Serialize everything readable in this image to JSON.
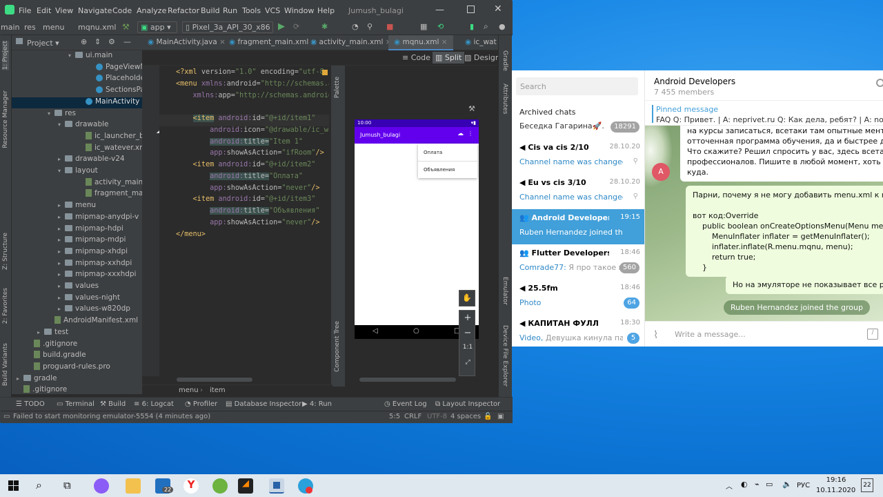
{
  "studio": {
    "menu": [
      "File",
      "Edit",
      "View",
      "Navigate",
      "Code",
      "Analyze",
      "Refactor",
      "Build",
      "Run",
      "Tools",
      "VCS",
      "Window",
      "Help"
    ],
    "project_name": "Jumush_bulagi",
    "toolbar": {
      "crumb_main": "main",
      "crumb_res": "res",
      "crumb_menu": "menu",
      "crumb_file": "mqnu.xml",
      "run_config": "app",
      "device": "Pixel_3a_API_30_x86"
    },
    "project_panel_label": "Project",
    "side_tabs_left": [
      "1: Project",
      "Resource Manager",
      "Z: Structure",
      "2: Favorites",
      "Build Variants"
    ],
    "side_tabs_right": [
      "Gradle",
      "Attributes",
      "Emulator",
      "Device File Explorer"
    ],
    "design_side_tabs": [
      "Palette",
      "Component Tree"
    ],
    "tree": [
      {
        "label": "ui.main",
        "indent": 110,
        "type": "folder",
        "arrow": "▾"
      },
      {
        "label": "PageViewM",
        "indent": 140,
        "type": "class",
        "arrow": ""
      },
      {
        "label": "Placeholder",
        "indent": 140,
        "type": "class",
        "arrow": ""
      },
      {
        "label": "SectionsPag",
        "indent": 140,
        "type": "class",
        "arrow": ""
      },
      {
        "label": "MainActivity",
        "indent": 125,
        "type": "class",
        "arrow": "",
        "selected": true
      },
      {
        "label": "res",
        "indent": 80,
        "type": "folder",
        "arrow": "▾"
      },
      {
        "label": "drawable",
        "indent": 95,
        "type": "folder",
        "arrow": "▾"
      },
      {
        "label": "ic_launcher_bac",
        "indent": 125,
        "type": "file",
        "arrow": ""
      },
      {
        "label": "ic_watever.xml",
        "indent": 125,
        "type": "file",
        "arrow": ""
      },
      {
        "label": "drawable-v24",
        "indent": 95,
        "type": "folder",
        "arrow": "▸"
      },
      {
        "label": "layout",
        "indent": 95,
        "type": "folder",
        "arrow": "▾"
      },
      {
        "label": "activity_main.x",
        "indent": 125,
        "type": "file",
        "arrow": ""
      },
      {
        "label": "fragment_main",
        "indent": 125,
        "type": "file",
        "arrow": ""
      },
      {
        "label": "menu",
        "indent": 95,
        "type": "folder",
        "arrow": "▸"
      },
      {
        "label": "mipmap-anydpi-v",
        "indent": 95,
        "type": "folder",
        "arrow": "▸"
      },
      {
        "label": "mipmap-hdpi",
        "indent": 95,
        "type": "folder",
        "arrow": "▸"
      },
      {
        "label": "mipmap-mdpi",
        "indent": 95,
        "type": "folder",
        "arrow": "▸"
      },
      {
        "label": "mipmap-xhdpi",
        "indent": 95,
        "type": "folder",
        "arrow": "▸"
      },
      {
        "label": "mipmap-xxhdpi",
        "indent": 95,
        "type": "folder",
        "arrow": "▸"
      },
      {
        "label": "mipmap-xxxhdpi",
        "indent": 95,
        "type": "folder",
        "arrow": "▸"
      },
      {
        "label": "values",
        "indent": 95,
        "type": "folder",
        "arrow": "▸"
      },
      {
        "label": "values-night",
        "indent": 95,
        "type": "folder",
        "arrow": "▸"
      },
      {
        "label": "values-w820dp",
        "indent": 95,
        "type": "folder",
        "arrow": "▸"
      },
      {
        "label": "AndroidManifest.xml",
        "indent": 80,
        "type": "file",
        "arrow": ""
      },
      {
        "label": "test",
        "indent": 65,
        "type": "folder",
        "arrow": "▸"
      },
      {
        "label": ".gitignore",
        "indent": 50,
        "type": "file",
        "arrow": ""
      },
      {
        "label": "build.gradle",
        "indent": 50,
        "type": "file",
        "arrow": ""
      },
      {
        "label": "proguard-rules.pro",
        "indent": 50,
        "type": "file",
        "arrow": ""
      },
      {
        "label": "gradle",
        "indent": 35,
        "type": "folder",
        "arrow": "▸"
      },
      {
        "label": ".gitignore",
        "indent": 35,
        "type": "file",
        "arrow": ""
      }
    ],
    "tabs": [
      "MainActivity.java",
      "fragment_main.xml",
      "activity_main.xml",
      "mqnu.xml",
      "ic_wat"
    ],
    "active_tab": 3,
    "view_modes": [
      "Code",
      "Split",
      "Design"
    ],
    "code": [
      {
        "n": "1",
        "html": "<span class='tag'>&lt;?xml</span> <span class='attr'>version=</span><span class='val'>\"1.0\"</span> <span class='attr'>encoding=</span><span class='val'>\"utf-8</span>"
      },
      {
        "n": "2",
        "html": "<span class='tag'>&lt;menu</span> <span class='ns'>xmlns:</span><span class='attr'>android=</span><span class='val'>\"http://schemas.a</span>"
      },
      {
        "n": "3",
        "html": "    <span class='ns'>xmlns:</span><span class='attr'>app=</span><span class='val'>\"http://schemas.android</span>"
      },
      {
        "n": "4",
        "html": ""
      },
      {
        "n": "5",
        "html": "    <span class='tag hlt'>&lt;item</span> <span class='ns'>android:</span><span class='attr'>id=</span><span class='val'>\"@+id/item1\"</span>"
      },
      {
        "n": "6",
        "html": "        <span class='ns'>android:</span><span class='attr'>icon=</span><span class='val'>\"@drawable/ic_wa</span>"
      },
      {
        "n": "7",
        "html": "        <span class='hlt'><span class='ns'>android:</span><span class='attr'>title=</span></span><span class='val'>\"Item 1\"</span>"
      },
      {
        "n": "8",
        "html": "        <span class='ns'>app:</span><span class='attr'>showAsAction=</span><span class='val'>\"ifRoom\"</span><span class='tag'>/&gt;</span>"
      },
      {
        "n": "9",
        "html": "    <span class='tag'>&lt;item</span> <span class='ns'>android:</span><span class='attr'>id=</span><span class='val'>\"@+id/item2\"</span>"
      },
      {
        "n": "10",
        "html": "        <span class='hlt'><span class='ns'>android:</span><span class='attr'>title=</span></span><span class='val'>\"Оплата\"</span>"
      },
      {
        "n": "11",
        "html": "        <span class='ns'>app:</span><span class='attr'>showAsAction=</span><span class='val'>\"never\"</span><span class='tag'>/&gt;</span>"
      },
      {
        "n": "12",
        "html": "    <span class='tag'>&lt;item</span> <span class='ns'>android:</span><span class='attr'>id=</span><span class='val'>\"@+id/item3\"</span>"
      },
      {
        "n": "13",
        "html": "        <span class='hlt'><span class='ns'>android:</span><span class='attr'>title=</span></span><span class='val'>\"Объявления\"</span>"
      },
      {
        "n": "14",
        "html": "        <span class='ns'>app:</span><span class='attr'>showAsAction=</span><span class='val'>\"never\"</span><span class='tag'>/&gt;</span>"
      },
      {
        "n": "15",
        "html": "<span class='tag'>&lt;/menu&gt;</span>"
      }
    ],
    "breadcrumb": [
      "menu",
      "item"
    ],
    "preview": {
      "time": "10:00",
      "app_title": "Jumush_bulagi",
      "menu_items": [
        "Оплата",
        "Объявления"
      ],
      "zoom_ratio": "1:1"
    },
    "bottom_tools": [
      "TODO",
      "Terminal",
      "Build",
      "6: Logcat",
      "Profiler",
      "Database Inspector",
      "4: Run",
      "Event Log",
      "Layout Inspector"
    ],
    "status": {
      "message": "Failed to start monitoring emulator-5554 (4 minutes ago)",
      "position": "5:5",
      "line_sep": "CRLF",
      "encoding": "UTF-8",
      "indent": "4 spaces"
    }
  },
  "telegram": {
    "search_placeholder": "Search",
    "archived": {
      "title": "Archived chats",
      "preview": "Беседка Гагарина🚀. F...",
      "badge": "18291"
    },
    "chats": [
      {
        "title": "Cis va cis 2/10",
        "date": "28.10.20",
        "preview_hl": "Channel name was changed ...",
        "preview": "",
        "badge": "",
        "pin": true
      },
      {
        "title": "Eu vs cis 3/10",
        "date": "28.10.20",
        "preview_hl": "Channel name was changed ...",
        "preview": "",
        "badge": "",
        "pin": true
      },
      {
        "title": "Android Developers",
        "date": "19:15",
        "preview_hl": "Ruben Hernandez joined the gro...",
        "preview": "",
        "badge": "",
        "selected": true
      },
      {
        "title": "Flutter Developers — p...",
        "date": "18:46",
        "preview_hl": "Comrade77:",
        "preview": " Я про такое н...",
        "badge": "560"
      },
      {
        "title": "25.5fm",
        "date": "18:46",
        "preview_hl": "Photo",
        "preview": "",
        "badge": "64",
        "blue": true
      },
      {
        "title": "КАПИТАН ФУЛЛ",
        "date": "18:30",
        "preview_hl": "Video,",
        "preview": " Девушка кинула паца...",
        "badge": "5",
        "blue": true
      }
    ],
    "header": {
      "title": "Android Developers",
      "members": "7 455 members"
    },
    "pinned": {
      "label": "Pinned message",
      "text": "FAQ Q: Привет. | A: neprivet.ru Q: Как дела, ребят? | A: nometa.xyz"
    },
    "messages": {
      "first": [
        "на курсы записаться, всетаки там опытные менторы,",
        "отточенная программа обучения, да и быстрее дело пойдет",
        "Что скажите? Решил спросить у вас, здесь всетаки много",
        "профессионалов. Пишите в любой момент, хоть в личку",
        "куда."
      ],
      "avatar_letter": "A",
      "second": [
        "Парни, почему я не могу добавить menu.xml к main_activity?",
        "",
        "вот код:Override",
        "    public boolean onCreateOptionsMenu(Menu menu) {",
        "        MenuInflater inflater = getMenuInflater();",
        "        inflater.inflate(R.menu.mqnu, menu);",
        "        return true;",
        "    }"
      ],
      "third": "Но на эмуляторе не показывает все равно",
      "service": "Ruben Hernandez joined the group"
    },
    "input_placeholder": "Write a message..."
  },
  "taskbar": {
    "lang": "РУС",
    "time": "19:16",
    "date": "10.11.2020",
    "notif": "22",
    "mail_badge": "22"
  }
}
